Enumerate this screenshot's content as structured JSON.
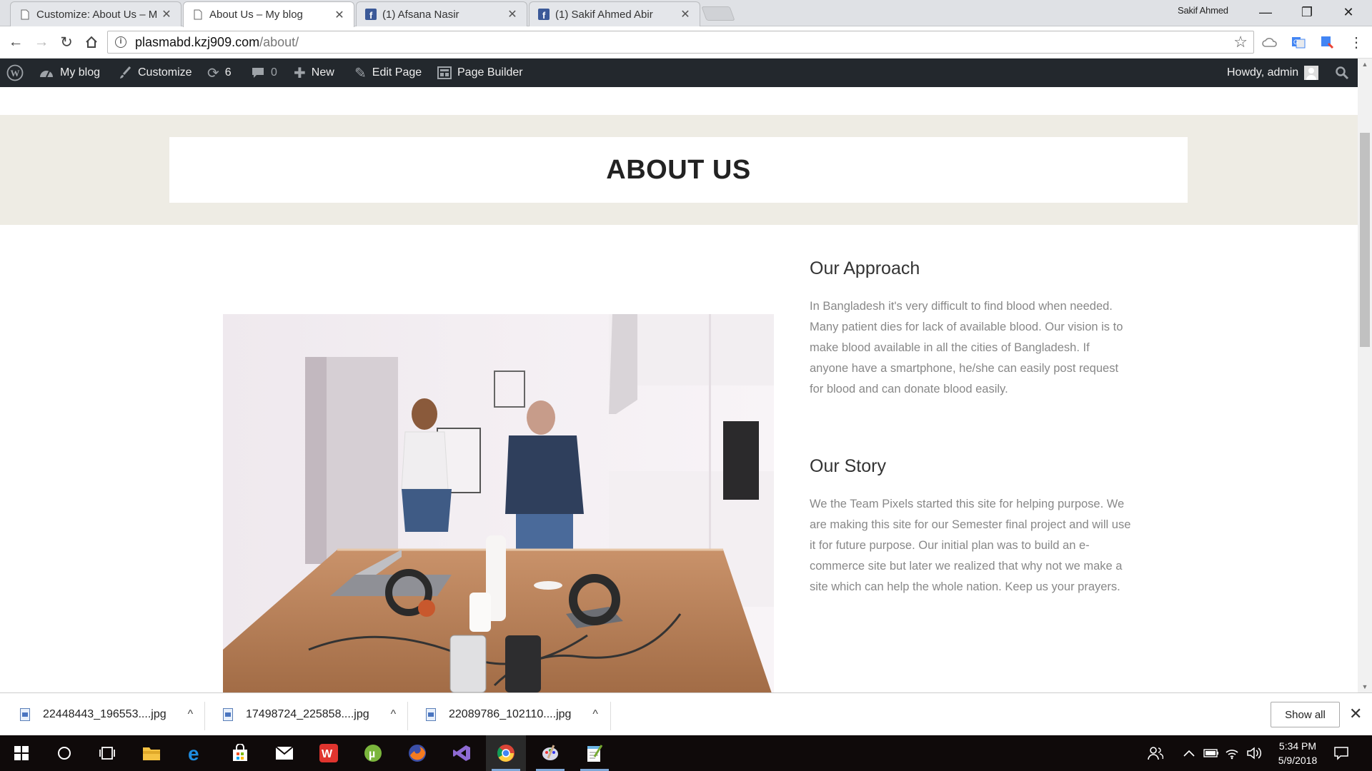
{
  "browser": {
    "tabs": [
      {
        "title": "Customize: About Us – M",
        "icon": "page-icon",
        "active": false
      },
      {
        "title": "About Us – My blog",
        "icon": "page-icon",
        "active": true
      },
      {
        "title": "(1) Afsana Nasir",
        "icon": "facebook-icon",
        "active": false
      },
      {
        "title": "(1) Sakif Ahmed Abir",
        "icon": "facebook-icon",
        "active": false
      }
    ],
    "profile_name": "Sakif Ahmed",
    "url_host": "plasmabd.kzj909.com",
    "url_path": "/about/"
  },
  "adminbar": {
    "site_name": "My blog",
    "customize": "Customize",
    "updates_count": "6",
    "comments_count": "0",
    "new": "New",
    "edit_page": "Edit Page",
    "page_builder": "Page Builder",
    "howdy": "Howdy, admin"
  },
  "page": {
    "title": "ABOUT US",
    "sections": [
      {
        "heading": "Our Approach",
        "text": "In Bangladesh it's very difficult to find blood when needed. Many patient dies for lack of available blood. Our vision is to make blood available in all the cities of Bangladesh. If anyone have a smartphone, he/she can easily post request for blood and can donate blood easily."
      },
      {
        "heading": "Our Story",
        "text": "We the Team Pixels started this site for helping purpose. We are making this site for our Semester final project and will use it for future purpose. Our initial plan was to build an e-commerce site but later we realized that why not we make a site which can help the whole nation. Keep us your prayers."
      }
    ]
  },
  "downloads": {
    "items": [
      "22448443_196553....jpg",
      "17498724_225858....jpg",
      "22089786_102110....jpg"
    ],
    "show_all": "Show all"
  },
  "taskbar": {
    "apps": [
      "start-icon",
      "search-icon",
      "task-view-icon",
      "file-explorer-icon",
      "edge-icon",
      "store-icon",
      "mail-icon",
      "wps-icon",
      "utorrent-icon",
      "firefox-icon",
      "visual-studio-icon",
      "chrome-icon",
      "paint-icon",
      "notepad-icon"
    ],
    "time": "5:34 PM",
    "date": "5/9/2018"
  }
}
